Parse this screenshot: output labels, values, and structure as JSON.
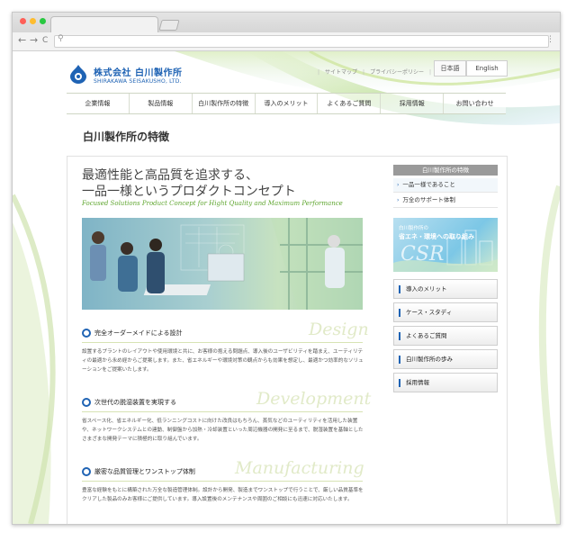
{
  "browser": {
    "dots": [
      "#ff5f57",
      "#febc2e",
      "#28c840"
    ],
    "back": "←",
    "forward": "→",
    "reload": "C",
    "search_glyph": "⚲",
    "menu_glyph": "⋮"
  },
  "site": {
    "company_name": "株式会社 白川製作所",
    "company_en": "SHIRAKAWA SEISAKUSHO, LTD.",
    "utility_links": [
      "サイトマップ",
      "プライバシーポリシー"
    ],
    "languages": [
      "日本語",
      "English"
    ],
    "brand_color": "#1f63b4",
    "accent_green": "#5fa62f"
  },
  "nav": [
    "企業情報",
    "製品情報",
    "白川製作所の特徴",
    "導入のメリット",
    "よくあるご質問",
    "採用情報",
    "お問い合わせ"
  ],
  "page_title": "白川製作所の特徴",
  "main": {
    "headline_1": "最適性能と高品質を追求する、",
    "headline_2": "一品一様というプロダクトコンセプト",
    "subheadline": "Focused Solutions Product Concept for Hight Quality and Maximum Performance",
    "sections": [
      {
        "title": "完全オーダーメイドによる設計",
        "en": "Design",
        "body": "設置するプラントのレイアウトや使用環境と共に、お客様の抱える問題点、導入後のユーザビリティを踏まえ、ユーティリティの最適から永め経からご提案します。また、省エネルギーや環境対策の観点からも効果を想定し、最適かつ効率的なソリューションをご提案いたします。"
      },
      {
        "title": "次世代の脱湿装置を実現する",
        "en": "Development",
        "body": "省スペース化、省エネルギー化、低ランニングコストに向けた改良はもちろん、蒸気などのユーティリティを活用した装置や、ネットワークシステムとの連動、制御盤から加熱・冷却装置といった周辺機器の開発に至るまで、脱湿装置を基軸としたさまざまな開発テーマに積極的に取り組んでいます。"
      },
      {
        "title": "厳密な品質管理とワンストップ体制",
        "en": "Manufacturing",
        "body": "豊富な経験をもとに構築された万全な製造管理体制。設計から開発、製造までワンストップで行うことで、厳しい品質基準をクリアした製品のみお客様にご提供しています。導入設置後のメンテナンスや周囲のご相談にも迅速に対応いたします。"
      }
    ]
  },
  "sidebar": {
    "heading": "白川製作所の特徴",
    "links": [
      "一品一様であること",
      "万全のサポート体制"
    ],
    "banner_small": "白川製作所の",
    "banner_title": "省エネ・環境への取り組み",
    "banner_word": "CSR",
    "buttons": [
      "導入のメリット",
      "ケース・スタディ",
      "よくあるご質問",
      "白川製作所の歩み",
      "採用情報"
    ]
  }
}
